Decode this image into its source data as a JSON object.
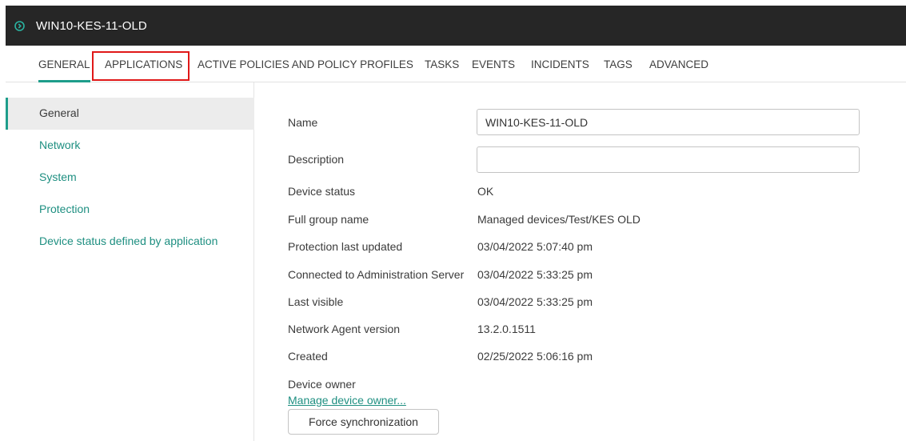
{
  "header": {
    "title": "WIN10-KES-11-OLD",
    "icon": "chevron-circle-icon",
    "background": "#262626",
    "accent": "#1e9d8b"
  },
  "tabs": [
    {
      "label": "GENERAL",
      "active": true
    },
    {
      "label": "APPLICATIONS",
      "highlighted": true
    },
    {
      "label": "ACTIVE POLICIES AND POLICY PROFILES"
    },
    {
      "label": "TASKS"
    },
    {
      "label": "EVENTS"
    },
    {
      "label": "INCIDENTS"
    },
    {
      "label": "TAGS"
    },
    {
      "label": "ADVANCED"
    }
  ],
  "sidebar": {
    "items": [
      {
        "label": "General",
        "active": true
      },
      {
        "label": "Network"
      },
      {
        "label": "System"
      },
      {
        "label": "Protection"
      },
      {
        "label": "Device status defined by application"
      }
    ]
  },
  "form": {
    "name": {
      "label": "Name",
      "value": "WIN10-KES-11-OLD"
    },
    "description": {
      "label": "Description",
      "value": ""
    },
    "rows": [
      {
        "label": "Device status",
        "value": "OK"
      },
      {
        "label": "Full group name",
        "value": "Managed devices/Test/KES OLD"
      },
      {
        "label": "Protection last updated",
        "value": "03/04/2022 5:07:40 pm"
      },
      {
        "label": "Connected to Administration Server",
        "value": "03/04/2022 5:33:25 pm"
      },
      {
        "label": "Last visible",
        "value": "03/04/2022 5:33:25 pm"
      },
      {
        "label": "Network Agent version",
        "value": "13.2.0.1511"
      },
      {
        "label": "Created",
        "value": "02/25/2022 5:06:16 pm"
      }
    ],
    "device_owner": {
      "label": "Device owner",
      "link": "Manage device owner...",
      "button": "Force synchronization"
    }
  }
}
